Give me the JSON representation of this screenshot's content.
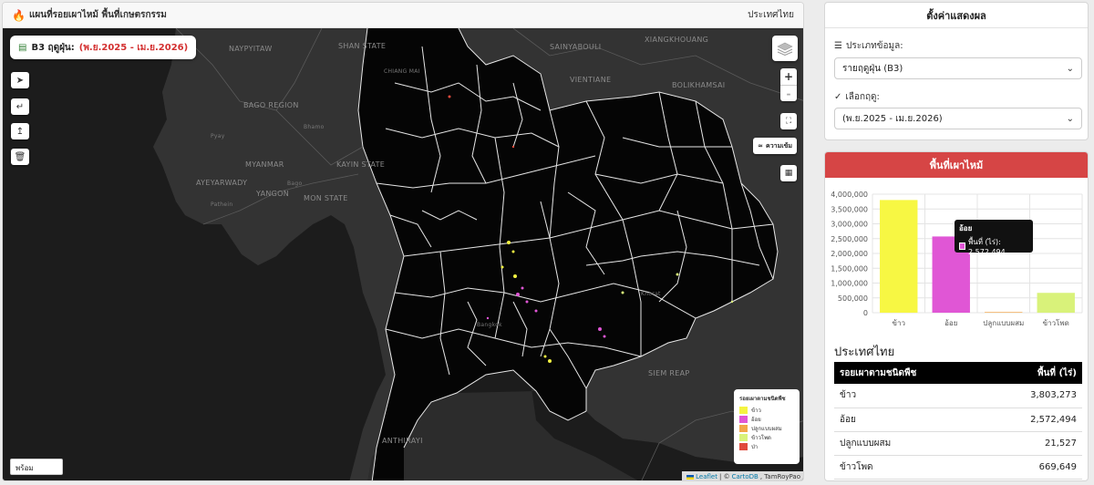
{
  "header": {
    "icon": "fire-icon",
    "title": "แผนที่รอยเผาไหม้ พื้นที่เกษตรกรรม",
    "region": "ประเทศไทย"
  },
  "season_chip": {
    "icon": "database-icon",
    "prefix": "B3 ฤดูฝุ่น:",
    "value": "(พ.ย.2025 - เม.ย.2026)"
  },
  "map": {
    "zoom_in": "+",
    "zoom_out": "-",
    "density_label": "ความเข้ม",
    "status": "พร้อม",
    "attribution": {
      "leaflet": "Leaflet",
      "separator": "| ©",
      "cartodb": "CartoDB",
      "author": ", TamRoyPao"
    },
    "place_labels": [
      "NAYPYITAW",
      "SHAN STATE",
      "CHIANG MAI",
      "BAGO REGION",
      "KAYIN STATE",
      "MYANMAR",
      "AYEYARWADY",
      "YANGON",
      "MON STATE",
      "SAINYABOULI",
      "XIANGKHOUANG",
      "VIENTIANE",
      "BOLIKHAMSAI",
      "SIEM REAP",
      "ANTHIRAYI",
      "Pyay",
      "Bago",
      "Pathein",
      "Bhamo",
      "Bangkok",
      "Khorat"
    ]
  },
  "legend": {
    "title": "รอยเผาตามชนิดพืช",
    "items": [
      {
        "label": "ข้าว",
        "color": "#f4f442"
      },
      {
        "label": "อ้อย",
        "color": "#e056d5"
      },
      {
        "label": "ปลูกแบบผสม",
        "color": "#f2a64a"
      },
      {
        "label": "ข้าวโพด",
        "color": "#d9f27a"
      },
      {
        "label": "ป่า",
        "color": "#e04a3c"
      }
    ]
  },
  "settings": {
    "title": "ตั้งค่าแสดงผล",
    "data_type_label": "ประเภทข้อมูล:",
    "data_type_icon": "layers-icon",
    "data_type_value": "รายฤดูฝุ่น (B3)",
    "season_label": "เลือกฤดู:",
    "season_icon": "check-circle-icon",
    "season_value": "(พ.ย.2025 - เม.ย.2026)"
  },
  "burn_area": {
    "title": "พื้นที่เผาไหม้",
    "tooltip": {
      "title": "อ้อย",
      "text": "พื้นที่ (ไร่): 2,572,494"
    },
    "country_title": "ประเทศไทย",
    "table_headers": [
      "รอยเผาตามชนิดพืช",
      "พื้นที่ (ไร่)"
    ],
    "table_rows": [
      [
        "ข้าว",
        "3,803,273"
      ],
      [
        "อ้อย",
        "2,572,494"
      ],
      [
        "ปลูกแบบผสม",
        "21,527"
      ],
      [
        "ข้าวโพด",
        "669,649"
      ]
    ]
  },
  "chart_data": {
    "type": "bar",
    "categories": [
      "ข้าว",
      "อ้อย",
      "ปลูกแบบผสม",
      "ข้าวโพด"
    ],
    "values": [
      3803273,
      2572494,
      21527,
      669649
    ],
    "colors": [
      "#f7f743",
      "#e056d5",
      "#f2a64a",
      "#d9f27a"
    ],
    "y_ticks": [
      "0",
      "500,000",
      "1,000,000",
      "1,500,000",
      "2,000,000",
      "2,500,000",
      "3,000,000",
      "3,500,000",
      "4,000,000"
    ],
    "ylim": [
      0,
      4000000
    ],
    "grid": true
  }
}
